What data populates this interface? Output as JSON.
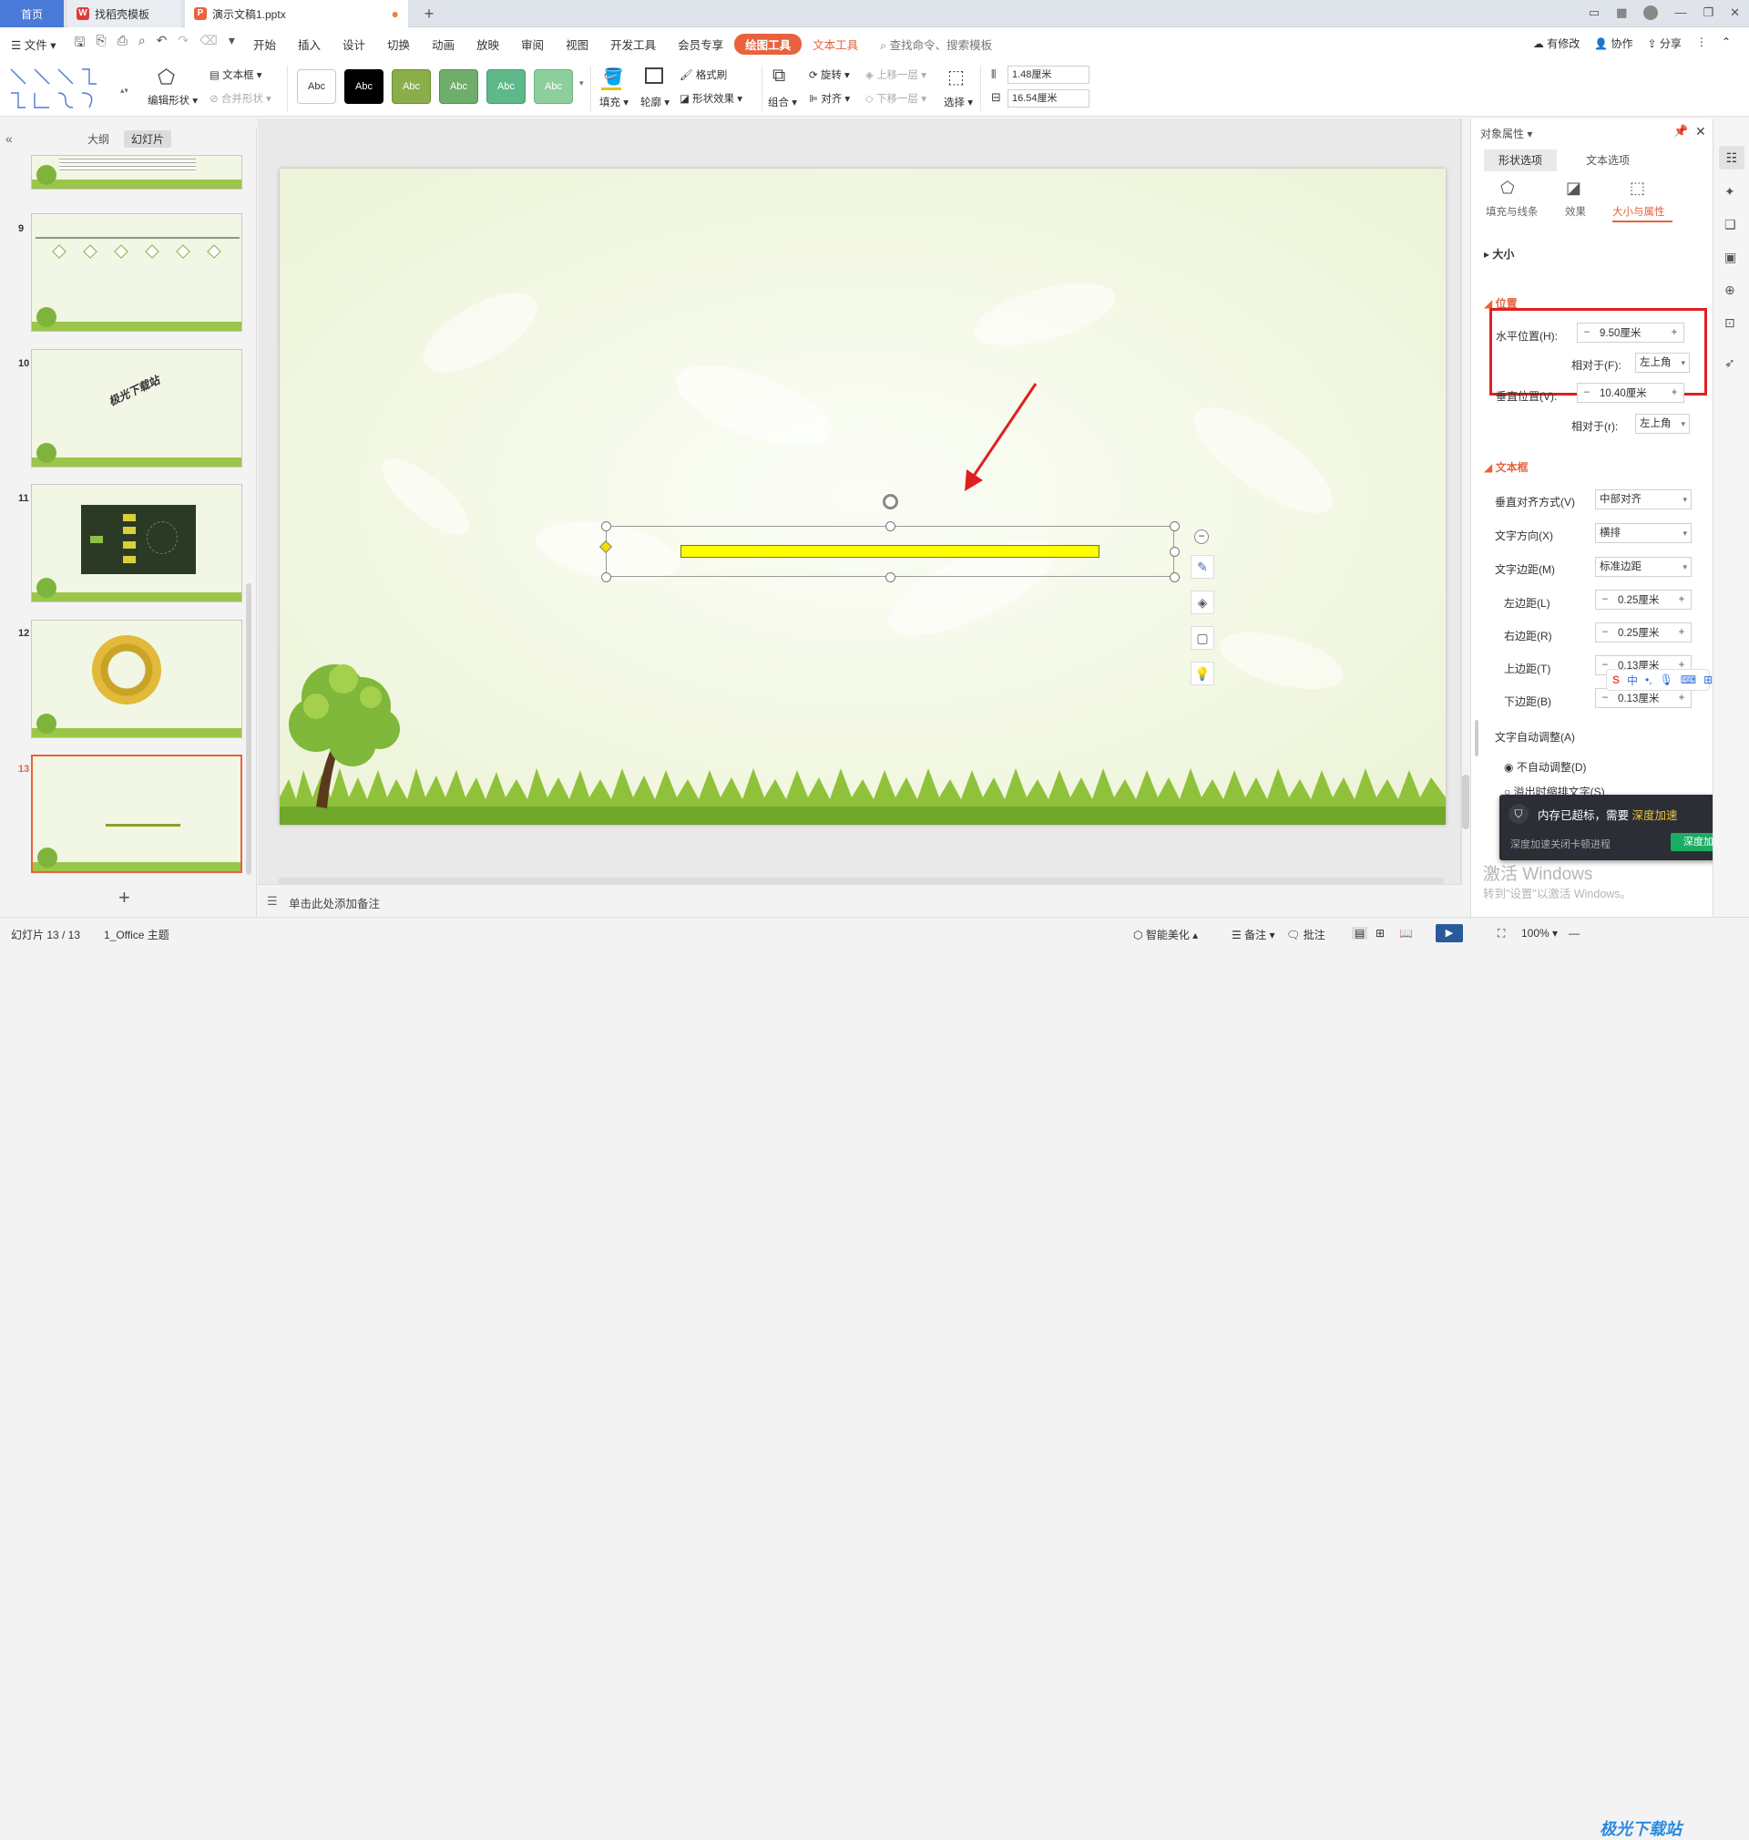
{
  "tabs": {
    "home": "首页",
    "template": "找稻壳模板",
    "document": "演示文稿1.pptx",
    "new_tab": "+"
  },
  "menu": {
    "file": "文件",
    "items": [
      "开始",
      "插入",
      "设计",
      "切换",
      "动画",
      "放映",
      "审阅",
      "视图",
      "开发工具",
      "会员专享"
    ],
    "drawing_tools": "绘图工具",
    "text_tools": "文本工具",
    "search": "查找命令、搜索模板",
    "modified": "有修改",
    "collab": "协作",
    "share": "分享"
  },
  "ribbon": {
    "edit_shape": "编辑形状",
    "textbox": "文本框",
    "merge_shape": "合并形状",
    "style_label": "Abc",
    "fill": "填充",
    "outline": "轮廓",
    "format_painter": "格式刷",
    "shape_effect": "形状效果",
    "group": "组合",
    "rotate": "旋转",
    "align": "对齐",
    "bring_forward": "上移一层",
    "send_backward": "下移一层",
    "select": "选择",
    "height": "1.48厘米",
    "width": "16.54厘米"
  },
  "left_panel": {
    "tab_outline": "大纲",
    "tab_slides": "幻灯片",
    "slide_numbers": [
      "9",
      "10",
      "11",
      "12",
      "13"
    ],
    "slide10_text": "极光下载站",
    "add": "+"
  },
  "right_panel": {
    "title": "对象属性",
    "tab_shape": "形状选项",
    "tab_text": "文本选项",
    "sub_fill": "填充与线条",
    "sub_effect": "效果",
    "sub_size": "大小与属性",
    "section_size": "大小",
    "section_position": "位置",
    "h_pos_label": "水平位置(H):",
    "h_pos_value": "9.50厘米",
    "relative_f_label": "相对于(F):",
    "relative_f_value": "左上角",
    "v_pos_label": "垂直位置(V):",
    "v_pos_value": "10.40厘米",
    "relative_r_label": "相对于(r):",
    "relative_r_value": "左上角",
    "section_textbox": "文本框",
    "valign_label": "垂直对齐方式(V)",
    "valign_value": "中部对齐",
    "dir_label": "文字方向(X)",
    "dir_value": "横排",
    "margin_label": "文字边距(M)",
    "margin_value": "标准边距",
    "left_label": "左边距(L)",
    "left_value": "0.25厘米",
    "right_label": "右边距(R)",
    "right_value": "0.25厘米",
    "top_label": "上边距(T)",
    "top_value": "0.13厘米",
    "bottom_label": "下边距(B)",
    "bottom_value": "0.13厘米",
    "autofit_label": "文字自动调整(A)",
    "no_autofit": "不自动调整(D)",
    "shrink_text": "溢出时缩排文字(S)"
  },
  "notification": {
    "title": "内存已超标，需要",
    "link": "深度加速",
    "sub": "深度加速关闭卡顿进程",
    "button": "深度加速"
  },
  "watermark": {
    "line1": "激活 Windows",
    "line2": "转到\"设置\"以激活 Windows。"
  },
  "notes_placeholder": "单击此处添加备注",
  "status": {
    "slide": "幻灯片 13 / 13",
    "theme": "1_Office 主题",
    "smart": "智能美化",
    "notes": "备注",
    "comment": "批注",
    "zoom": "100%"
  },
  "ime": {
    "lang": "中"
  },
  "site_watermark": "极光下载站"
}
